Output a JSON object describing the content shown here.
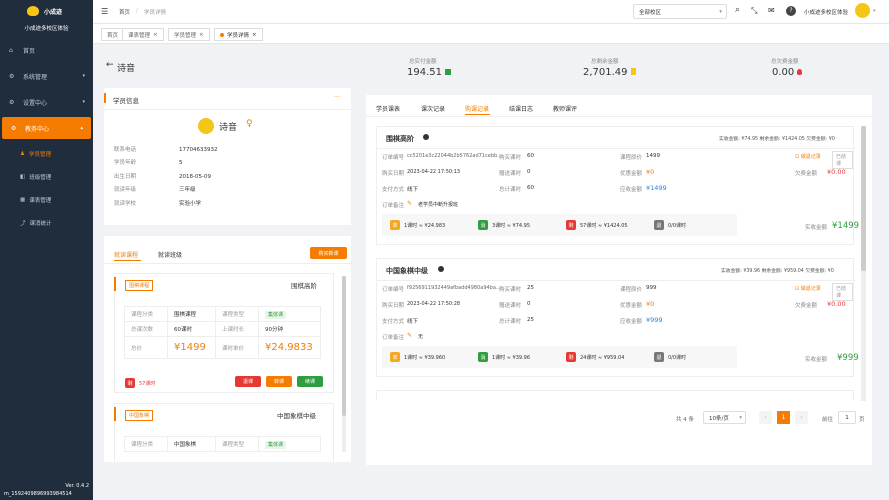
{
  "brand": {
    "name": "小成迹",
    "sub": "小成迹多校区体验"
  },
  "menu": [
    {
      "icon": "⌂",
      "label": "首页"
    },
    {
      "icon": "⚙",
      "label": "系统管理"
    },
    {
      "icon": "⚙",
      "label": "设置中心"
    },
    {
      "icon": "⚙",
      "label": "教务中心"
    }
  ],
  "submenu": [
    "学员管理",
    "班级管理",
    "课表管理",
    "课消统计"
  ],
  "footer": {
    "version": "Ver. 0.4.2",
    "uid": "m_1592409896993984514"
  },
  "breadcrumb": {
    "home": "首页",
    "sep": "/",
    "current": "学员详情"
  },
  "topbar": {
    "campus": "全部校区",
    "user": "小成迹多校区体验"
  },
  "tabs": [
    "首页",
    "课表管理",
    "学员管理",
    "学员详情"
  ],
  "student": {
    "name": "诗音",
    "back": "←",
    "header": "学员信息",
    "more": "···",
    "fields": [
      {
        "k": "联系电话",
        "v": "17704633932"
      },
      {
        "k": "学员年龄",
        "v": "5"
      },
      {
        "k": "出生日期",
        "v": "2018-05-09"
      },
      {
        "k": "就读年级",
        "v": "三年级"
      },
      {
        "k": "就读学校",
        "v": "实验小学"
      }
    ]
  },
  "stats": [
    {
      "label": "总实付金额",
      "value": "194.51"
    },
    {
      "label": "总剩余金额",
      "value": "2,701.49"
    },
    {
      "label": "总欠费金额",
      "value": "0.00"
    }
  ],
  "course_tabs": {
    "t1": "就读课程",
    "t2": "就读班级",
    "buy": "购买新课"
  },
  "courses": [
    {
      "tag": "围棋课程",
      "name": "围棋高阶",
      "rows": [
        [
          "课程分类",
          "围棋课程",
          "课程类型",
          "集体课"
        ],
        [
          "总课次数",
          "60课时",
          "上课时长",
          "90分钟"
        ],
        [
          "总价",
          "¥1499",
          "课时单价",
          "¥24.9833"
        ]
      ],
      "remain": "57课时",
      "b1": "退课",
      "b2": "转课",
      "b3": "续课"
    },
    {
      "tag": "中国象棋",
      "name": "中国象棋中级",
      "rows": [
        [
          "课程分类",
          "中国象棋",
          "课程类型",
          "集体课"
        ]
      ]
    }
  ],
  "right_tabs": [
    "学员课表",
    "课次记录",
    "购课记录",
    "结课日志",
    "教师课评"
  ],
  "orders": [
    {
      "title": "围棋高阶",
      "summary": "实收金额: ¥74.95 剩余金额: ¥1424.05 欠费金额: ¥0",
      "order_no": "cc5201e3c22044b2b5762ad71cebb...",
      "buy_hours": "60",
      "price": "1499",
      "buy_date": "2023-04-22 17:50:13",
      "gift": "0",
      "discount": "¥0",
      "pay": "线下",
      "total_hours": "60",
      "payable": "¥1499",
      "debt": "¥0.00",
      "note": "老学员中断升报班",
      "s1": "1课时 ≈ ¥24.983",
      "s2": "3课时 ≈ ¥74.95",
      "s3": "57课时 ≈ ¥1424.05",
      "s4": "0/0课时",
      "received": "¥1499"
    },
    {
      "title": "中国象棋中级",
      "summary": "实收金额: ¥39.96 剩余金额: ¥959.04 欠费金额: ¥0",
      "order_no": "f9256911932449afbadd4980a94ba...",
      "buy_hours": "25",
      "price": "999",
      "buy_date": "2023-04-22 17:50:28",
      "gift": "0",
      "discount": "¥0",
      "pay": "线下",
      "total_hours": "25",
      "payable": "¥999",
      "debt": "¥0.00",
      "note": "无",
      "s1": "1课时 ≈ ¥39.960",
      "s2": "1课时 ≈ ¥39.96",
      "s3": "24课时 ≈ ¥959.04",
      "s4": "0/0课时",
      "received": "¥999"
    }
  ],
  "order_labels": {
    "order_no": "订单编号",
    "buy_hours": "购买课时",
    "price": "课程原价",
    "buy_date": "购买日期",
    "gift": "赠送课时",
    "discount": "优惠金额",
    "pay": "支付方式",
    "total": "总计课时",
    "payable": "应收金额",
    "debt": "欠费金额",
    "note": "订单备注",
    "received": "实收金额",
    "refund": "做退记录",
    "finish": "已结课"
  },
  "pager": {
    "total": "共 4 条",
    "size": "10条/页",
    "page": "1",
    "goto": "前往",
    "goto_val": "1",
    "unit": "页"
  }
}
